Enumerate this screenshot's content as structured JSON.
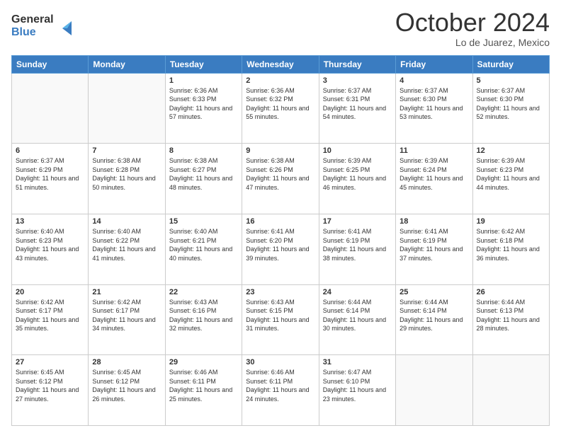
{
  "header": {
    "logo_line1": "General",
    "logo_line2": "Blue",
    "month": "October 2024",
    "location": "Lo de Juarez, Mexico"
  },
  "weekdays": [
    "Sunday",
    "Monday",
    "Tuesday",
    "Wednesday",
    "Thursday",
    "Friday",
    "Saturday"
  ],
  "weeks": [
    [
      {
        "day": "",
        "info": ""
      },
      {
        "day": "",
        "info": ""
      },
      {
        "day": "1",
        "info": "Sunrise: 6:36 AM\nSunset: 6:33 PM\nDaylight: 11 hours and 57 minutes."
      },
      {
        "day": "2",
        "info": "Sunrise: 6:36 AM\nSunset: 6:32 PM\nDaylight: 11 hours and 55 minutes."
      },
      {
        "day": "3",
        "info": "Sunrise: 6:37 AM\nSunset: 6:31 PM\nDaylight: 11 hours and 54 minutes."
      },
      {
        "day": "4",
        "info": "Sunrise: 6:37 AM\nSunset: 6:30 PM\nDaylight: 11 hours and 53 minutes."
      },
      {
        "day": "5",
        "info": "Sunrise: 6:37 AM\nSunset: 6:30 PM\nDaylight: 11 hours and 52 minutes."
      }
    ],
    [
      {
        "day": "6",
        "info": "Sunrise: 6:37 AM\nSunset: 6:29 PM\nDaylight: 11 hours and 51 minutes."
      },
      {
        "day": "7",
        "info": "Sunrise: 6:38 AM\nSunset: 6:28 PM\nDaylight: 11 hours and 50 minutes."
      },
      {
        "day": "8",
        "info": "Sunrise: 6:38 AM\nSunset: 6:27 PM\nDaylight: 11 hours and 48 minutes."
      },
      {
        "day": "9",
        "info": "Sunrise: 6:38 AM\nSunset: 6:26 PM\nDaylight: 11 hours and 47 minutes."
      },
      {
        "day": "10",
        "info": "Sunrise: 6:39 AM\nSunset: 6:25 PM\nDaylight: 11 hours and 46 minutes."
      },
      {
        "day": "11",
        "info": "Sunrise: 6:39 AM\nSunset: 6:24 PM\nDaylight: 11 hours and 45 minutes."
      },
      {
        "day": "12",
        "info": "Sunrise: 6:39 AM\nSunset: 6:23 PM\nDaylight: 11 hours and 44 minutes."
      }
    ],
    [
      {
        "day": "13",
        "info": "Sunrise: 6:40 AM\nSunset: 6:23 PM\nDaylight: 11 hours and 43 minutes."
      },
      {
        "day": "14",
        "info": "Sunrise: 6:40 AM\nSunset: 6:22 PM\nDaylight: 11 hours and 41 minutes."
      },
      {
        "day": "15",
        "info": "Sunrise: 6:40 AM\nSunset: 6:21 PM\nDaylight: 11 hours and 40 minutes."
      },
      {
        "day": "16",
        "info": "Sunrise: 6:41 AM\nSunset: 6:20 PM\nDaylight: 11 hours and 39 minutes."
      },
      {
        "day": "17",
        "info": "Sunrise: 6:41 AM\nSunset: 6:19 PM\nDaylight: 11 hours and 38 minutes."
      },
      {
        "day": "18",
        "info": "Sunrise: 6:41 AM\nSunset: 6:19 PM\nDaylight: 11 hours and 37 minutes."
      },
      {
        "day": "19",
        "info": "Sunrise: 6:42 AM\nSunset: 6:18 PM\nDaylight: 11 hours and 36 minutes."
      }
    ],
    [
      {
        "day": "20",
        "info": "Sunrise: 6:42 AM\nSunset: 6:17 PM\nDaylight: 11 hours and 35 minutes."
      },
      {
        "day": "21",
        "info": "Sunrise: 6:42 AM\nSunset: 6:17 PM\nDaylight: 11 hours and 34 minutes."
      },
      {
        "day": "22",
        "info": "Sunrise: 6:43 AM\nSunset: 6:16 PM\nDaylight: 11 hours and 32 minutes."
      },
      {
        "day": "23",
        "info": "Sunrise: 6:43 AM\nSunset: 6:15 PM\nDaylight: 11 hours and 31 minutes."
      },
      {
        "day": "24",
        "info": "Sunrise: 6:44 AM\nSunset: 6:14 PM\nDaylight: 11 hours and 30 minutes."
      },
      {
        "day": "25",
        "info": "Sunrise: 6:44 AM\nSunset: 6:14 PM\nDaylight: 11 hours and 29 minutes."
      },
      {
        "day": "26",
        "info": "Sunrise: 6:44 AM\nSunset: 6:13 PM\nDaylight: 11 hours and 28 minutes."
      }
    ],
    [
      {
        "day": "27",
        "info": "Sunrise: 6:45 AM\nSunset: 6:12 PM\nDaylight: 11 hours and 27 minutes."
      },
      {
        "day": "28",
        "info": "Sunrise: 6:45 AM\nSunset: 6:12 PM\nDaylight: 11 hours and 26 minutes."
      },
      {
        "day": "29",
        "info": "Sunrise: 6:46 AM\nSunset: 6:11 PM\nDaylight: 11 hours and 25 minutes."
      },
      {
        "day": "30",
        "info": "Sunrise: 6:46 AM\nSunset: 6:11 PM\nDaylight: 11 hours and 24 minutes."
      },
      {
        "day": "31",
        "info": "Sunrise: 6:47 AM\nSunset: 6:10 PM\nDaylight: 11 hours and 23 minutes."
      },
      {
        "day": "",
        "info": ""
      },
      {
        "day": "",
        "info": ""
      }
    ]
  ]
}
